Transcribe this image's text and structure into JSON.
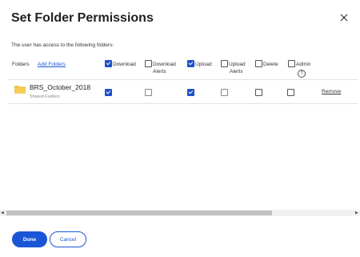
{
  "dialog": {
    "title": "Set Folder Permissions",
    "close_icon": "close-icon"
  },
  "intro_text": "The user has access to the following folders:",
  "table": {
    "folders_header": "Folders",
    "add_folders_link": "Add Folders",
    "columns": [
      {
        "key": "download",
        "label": "Download",
        "label2": "",
        "checked": true
      },
      {
        "key": "download_alerts",
        "label": "Download",
        "label2": "Alerts",
        "checked": false
      },
      {
        "key": "upload",
        "label": "Upload",
        "label2": "",
        "checked": true
      },
      {
        "key": "upload_alerts",
        "label": "Upload",
        "label2": "Alerts",
        "checked": false
      },
      {
        "key": "delete",
        "label": "Delete",
        "label2": "",
        "checked": false
      },
      {
        "key": "admin",
        "label": "Admin",
        "label2": "",
        "checked": false
      }
    ],
    "admin_help_icon": "help-circle-icon",
    "rows": [
      {
        "folder_name": "BRS_October_2018",
        "folder_subtitle": "Shared Folders",
        "folder_icon": "folder-icon",
        "permissions": {
          "download": true,
          "download_alerts": false,
          "upload": true,
          "upload_alerts": false,
          "delete": false,
          "admin": false
        },
        "remove_label": "Remove"
      }
    ]
  },
  "footer": {
    "done_label": "Done",
    "cancel_label": "Cancel"
  },
  "colors": {
    "accent": "#1a56d6",
    "checkbox_checked": "#1f50c8",
    "folder": "#f5c242"
  }
}
